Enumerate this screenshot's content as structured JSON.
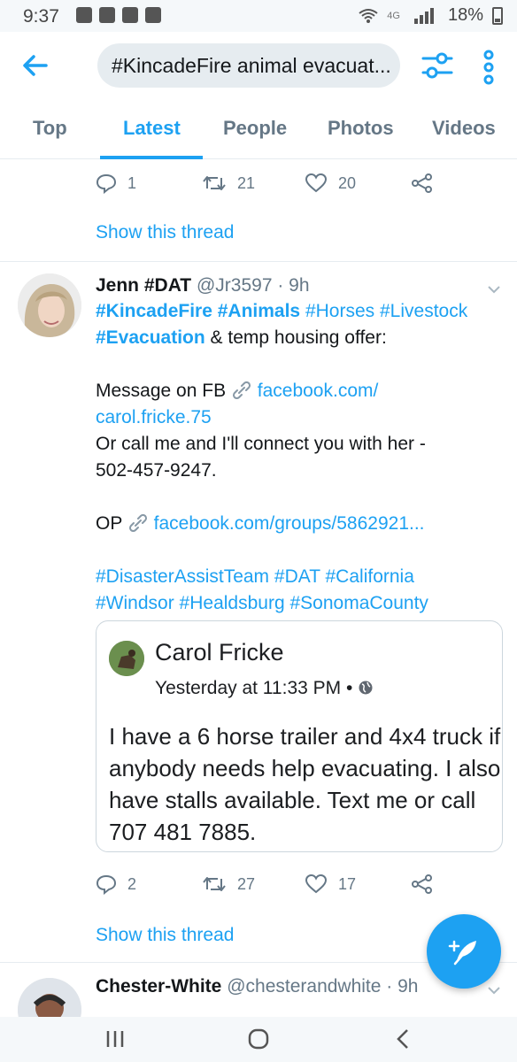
{
  "status_bar": {
    "time": "9:37",
    "network": "4G",
    "battery": "18%"
  },
  "header": {
    "search_query": "#KincadeFire animal evacuat..."
  },
  "tabs": [
    {
      "label": "Top",
      "active": false
    },
    {
      "label": "Latest",
      "active": true
    },
    {
      "label": "People",
      "active": false
    },
    {
      "label": "Photos",
      "active": false
    },
    {
      "label": "Videos",
      "active": false
    }
  ],
  "tweets": [
    {
      "replies": "1",
      "retweets": "21",
      "likes": "20",
      "show_thread": "Show this thread"
    },
    {
      "name": "Jenn #DAT",
      "handle": "@Jr3597",
      "time": "· 9h",
      "text_lines": {
        "l1": {
          "a": "#KincadeFire",
          "b": "#Animals",
          "c": "#Horses",
          "d": "#Livestock"
        },
        "l2": {
          "a": "#Evacuation",
          "b": " & temp housing offer:"
        },
        "l3": {
          "a": "Message on FB ",
          "b": "facebook.com/"
        },
        "l4": "carol.fricke.75",
        "l5": "Or call me and I'll connect you with her -",
        "l6": "502-457-9247.",
        "l7": {
          "a": "OP ",
          "b": "facebook.com/groups/5862921..."
        },
        "l8": {
          "a": "#DisasterAssistTeam",
          "b": "#DAT",
          "c": "#California"
        },
        "l9": {
          "a": "#Windsor",
          "b": "#Healdsburg",
          "c": "#SonomaCounty"
        }
      },
      "card": {
        "name": "Carol Fricke",
        "time": "Yesterday at 11:33 PM •",
        "body": [
          "I have a 6 horse trailer and 4x4 truck if",
          "anybody needs help evacuating.   I also",
          "have stalls available.  Text me or call",
          "707 481 7885."
        ]
      },
      "replies": "2",
      "retweets": "27",
      "likes": "17",
      "show_thread": "Show this thread"
    },
    {
      "name": "Chester-White",
      "handle": "@chesterandwhite",
      "time": "· 9h"
    }
  ],
  "colors": {
    "accent": "#1da1f2",
    "secondary_text": "#657786"
  }
}
